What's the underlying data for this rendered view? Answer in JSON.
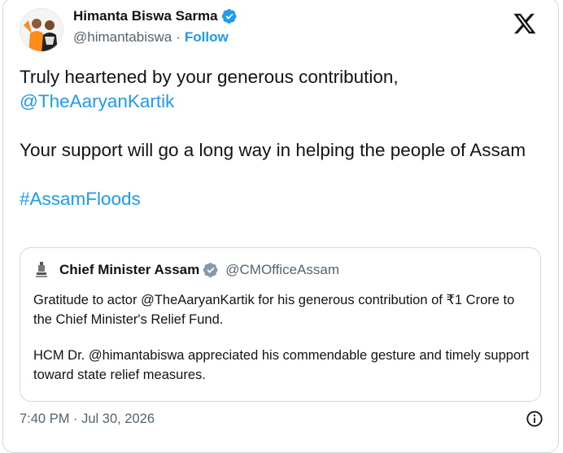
{
  "author": {
    "name": "Himanta Biswa Sarma",
    "handle": "@himantabiswa",
    "separator": "·",
    "follow_label": "Follow"
  },
  "tweet": {
    "line1": "Truly heartened by your generous contribution,",
    "mention": "@TheAaryanKartik",
    "line2": "Your support will go a long way in helping the people of Assam",
    "hashtag": "#AssamFloods"
  },
  "quoted": {
    "name": "Chief Minister Assam",
    "handle": "@CMOfficeAssam",
    "para1": "Gratitude to actor @TheAaryanKartik for his generous contribution of ₹1 Crore to the Chief Minister's Relief Fund.",
    "para2": "HCM Dr. @himantabiswa appreciated his commendable gesture and timely support toward state relief measures."
  },
  "footer": {
    "timestamp": "7:40 PM · Jul 30, 2026"
  },
  "icons": {
    "verified": "verified-badge-icon",
    "platform": "x-logo-icon",
    "info": "info-icon",
    "emblem": "state-emblem-icon"
  },
  "colors": {
    "accent": "#1d9bf0",
    "text": "#0f1419",
    "muted": "#536471",
    "border": "#cfd9de"
  }
}
